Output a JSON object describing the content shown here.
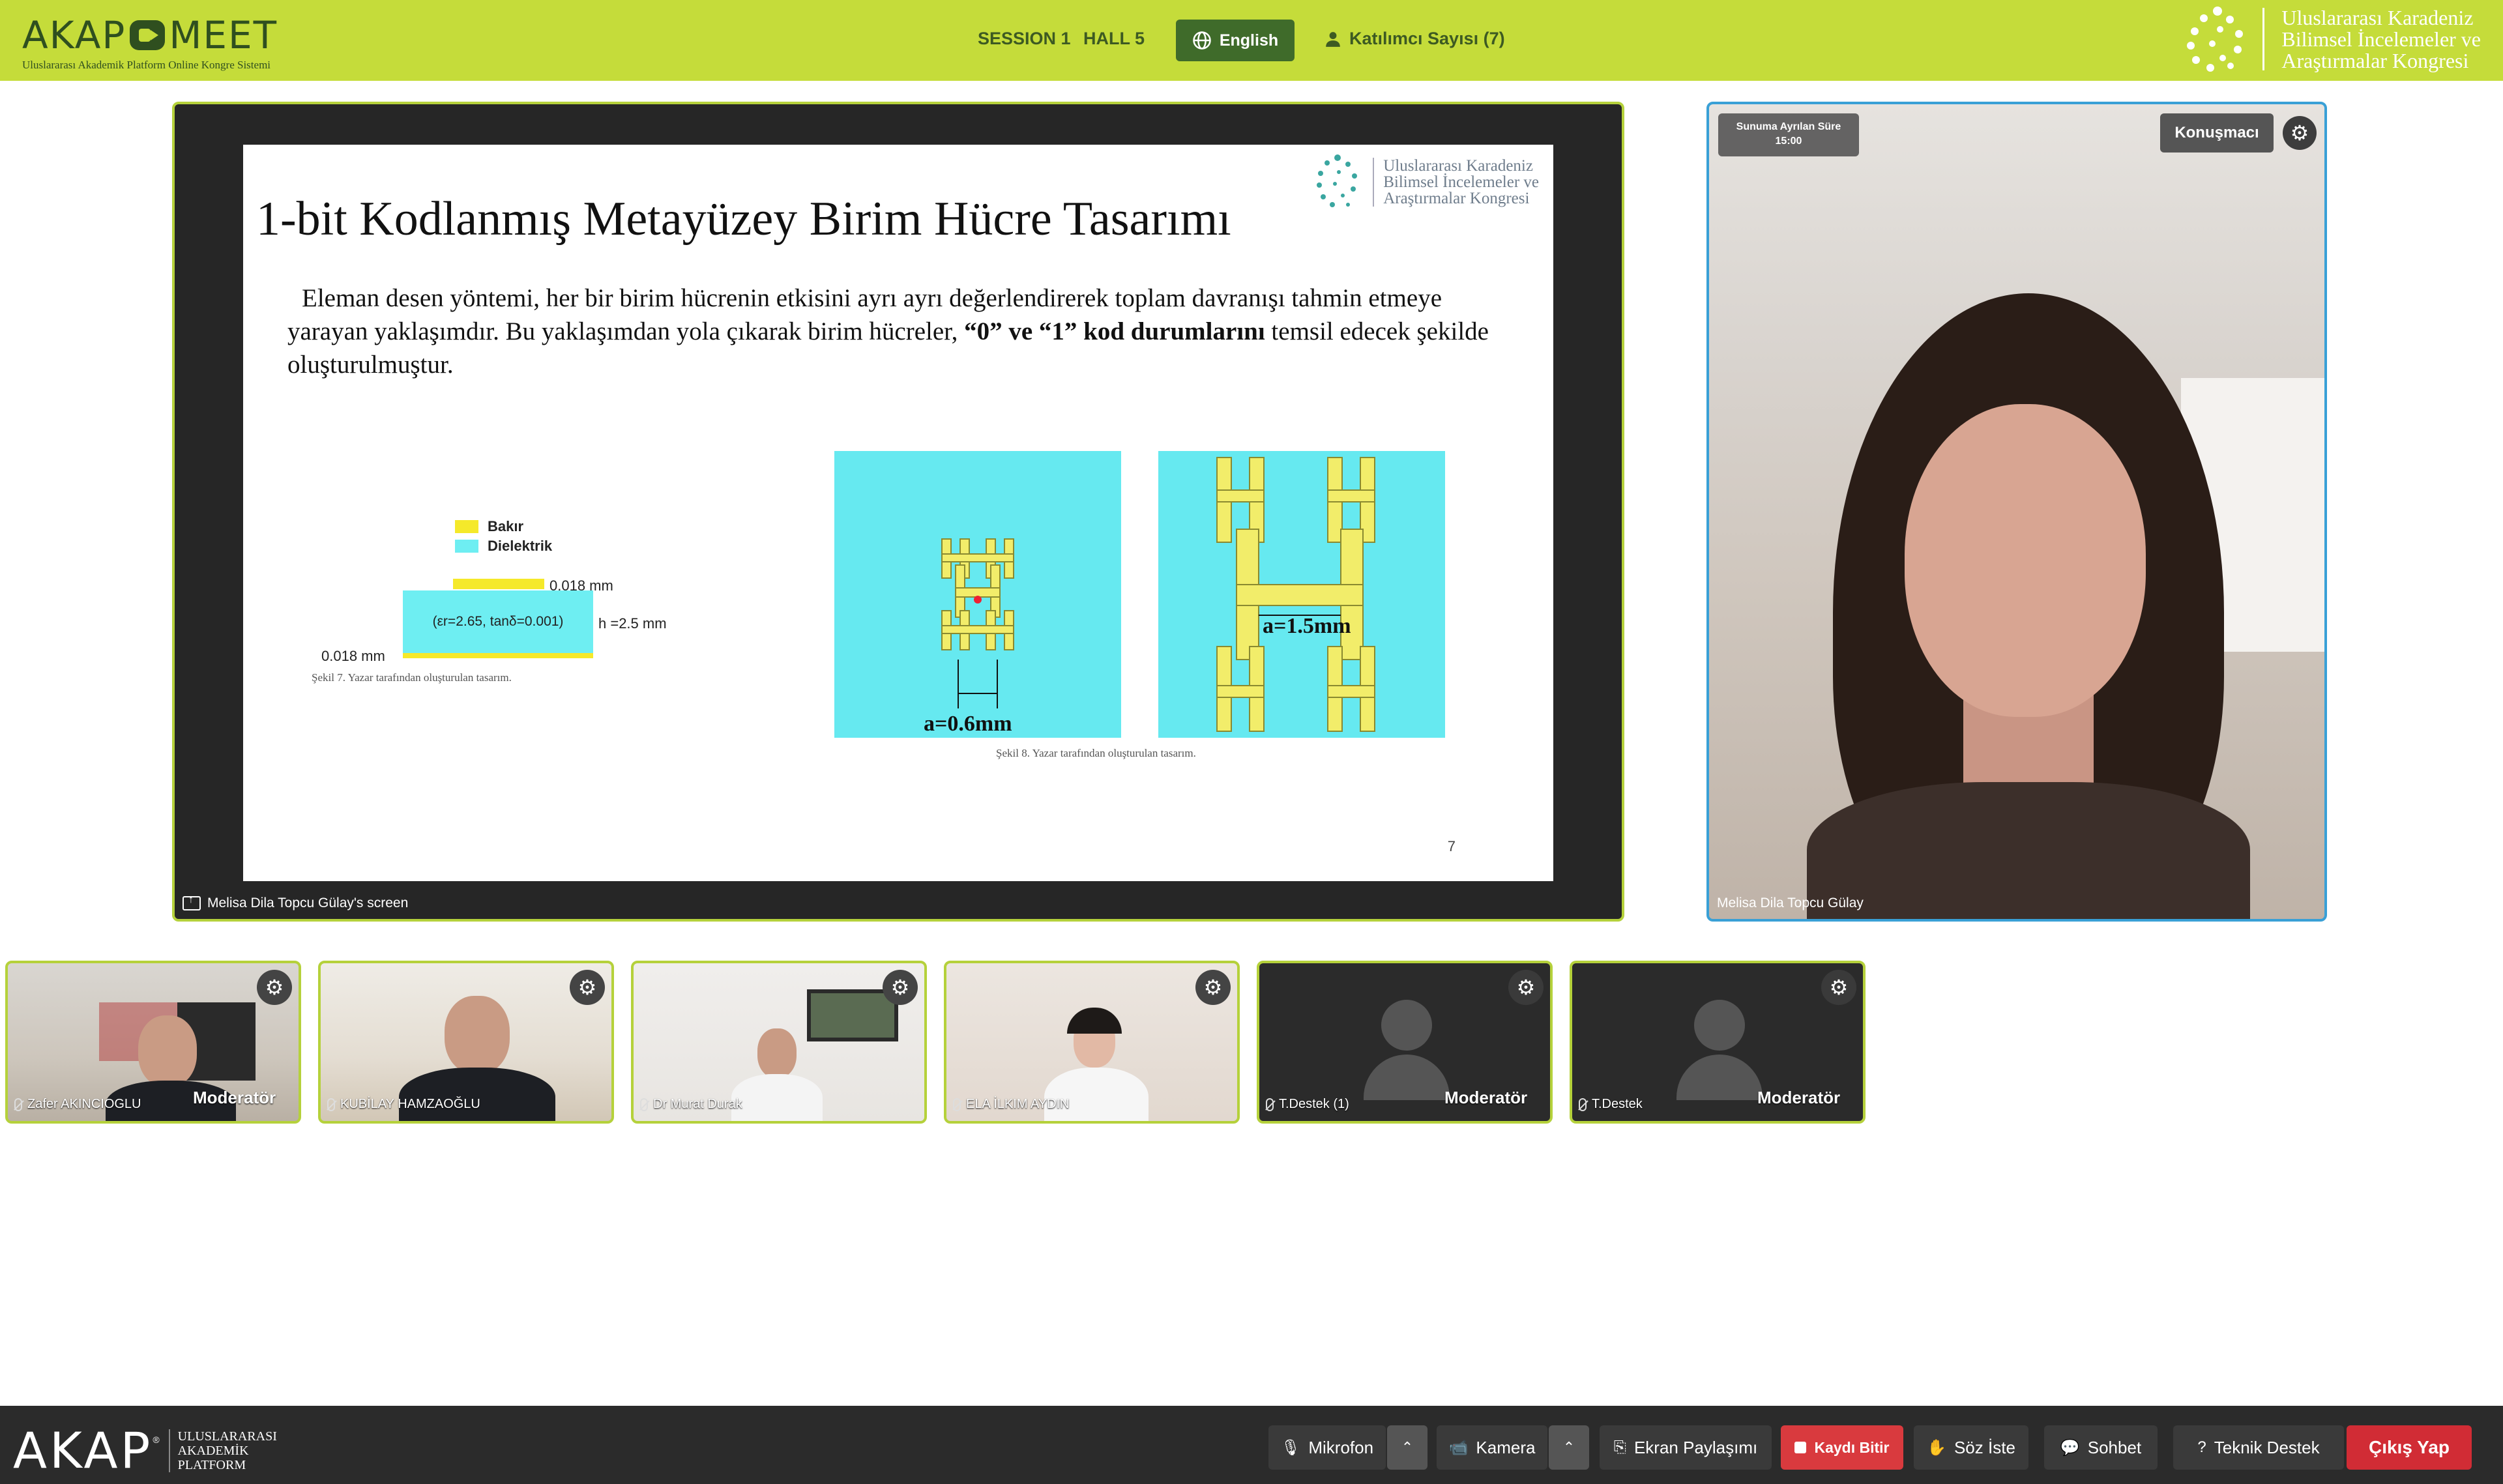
{
  "header": {
    "brand_name_left": "AKAP",
    "brand_name_right": "MEET",
    "brand_subtitle": "Uluslararası Akademik Platform Online Kongre Sistemi",
    "session": "SESSION 1",
    "hall": "HALL 5",
    "language_button": "English",
    "participants_label": "Katılımcı Sayısı (7)",
    "congress_name": [
      "Uluslararası Karadeniz",
      "Bilimsel İncelemeler ve",
      "Araştırmalar Kongresi"
    ]
  },
  "stage": {
    "label": "Melisa Dila Topcu Gülay's screen",
    "slide": {
      "title": "1-bit Kodlanmış Metayüzey Birim Hücre Tasarımı",
      "logo_text": [
        "Uluslararası Karadeniz",
        "Bilimsel İncelemeler ve",
        "Araştırmalar Kongresi"
      ],
      "body_part1": "Eleman desen yöntemi, her bir birim hücrenin etkisini ayrı ayrı değerlendirerek toplam davranışı tahmin etmeye yarayan yaklaşımdır. Bu yaklaşımdan yola çıkarak birim hücreler, ",
      "body_bold": "“0” ve “1” kod durumlarını",
      "body_part2": " temsil edecek şekilde oluşturulmuştur.",
      "legend_copper": "Bakır",
      "legend_dielectric": "Dielektrik",
      "dim_top": "0.018 mm",
      "dim_height": "h =2.5 mm",
      "dim_bottom": "0.018 mm",
      "substrate_params": "(εr=2.65, tanδ=0.001)",
      "caption_7": "Şekil 7. Yazar tarafından oluşturulan tasarım.",
      "label_a06": "a=0.6mm",
      "label_a15": "a=1.5mm",
      "caption_8": "Şekil 8. Yazar tarafından oluşturulan tasarım.",
      "page_number": "7"
    }
  },
  "speaker": {
    "timer_label": "Sunuma Ayrılan Süre",
    "timer_value": "15:00",
    "badge": "Konuşmacı",
    "name": "Melisa Dila Topcu Gülay"
  },
  "participants": [
    {
      "name": "Zafer AKINCIOGLU",
      "role": "Moderatör"
    },
    {
      "name": "KUBİLAY HAMZAOĞLU",
      "role": ""
    },
    {
      "name": "Dr Murat Durak",
      "role": ""
    },
    {
      "name": "ELA İLKIM AYDIN",
      "role": ""
    },
    {
      "name": "T.Destek (1)",
      "role": "Moderatör"
    },
    {
      "name": "T.Destek",
      "role": "Moderatör"
    }
  ],
  "toolbar": {
    "brand": "AKAP",
    "brand_sub": [
      "ULUSLARARASI",
      "AKADEMİK",
      "PLATFORM"
    ],
    "mic": "Mikrofon",
    "camera": "Kamera",
    "screen_share": "Ekran Paylaşımı",
    "record_stop": "Kaydı Bitir",
    "raise_hand": "Söz İste",
    "chat": "Sohbet",
    "support": "Teknik Destek",
    "exit": "Çıkış Yap"
  },
  "colors": {
    "header_green": "#c5dc3a",
    "dark_green": "#3f6b2a",
    "toolbar_bg": "#2b2b2b",
    "record_red": "#d93a3e",
    "exit_red": "#d12c35",
    "speaker_border": "#39a0d6"
  }
}
